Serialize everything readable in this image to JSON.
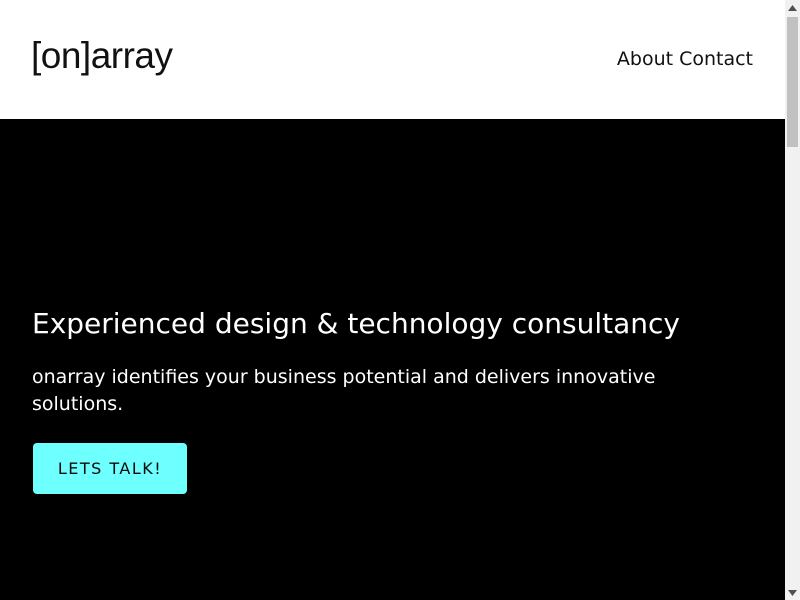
{
  "header": {
    "logo_text": "[on]array",
    "nav": [
      {
        "label": "About"
      },
      {
        "label": "Contact"
      }
    ]
  },
  "hero": {
    "title": "Experienced design & technology consultancy",
    "subtitle": "onarray identifies your business potential and delivers innovative solutions.",
    "cta_label": "LETS TALK!",
    "cta_color": "#6effff",
    "background_color": "#000000"
  },
  "scrollbar": {
    "up_icon": "triangle-up-icon",
    "down_icon": "triangle-down-icon"
  }
}
